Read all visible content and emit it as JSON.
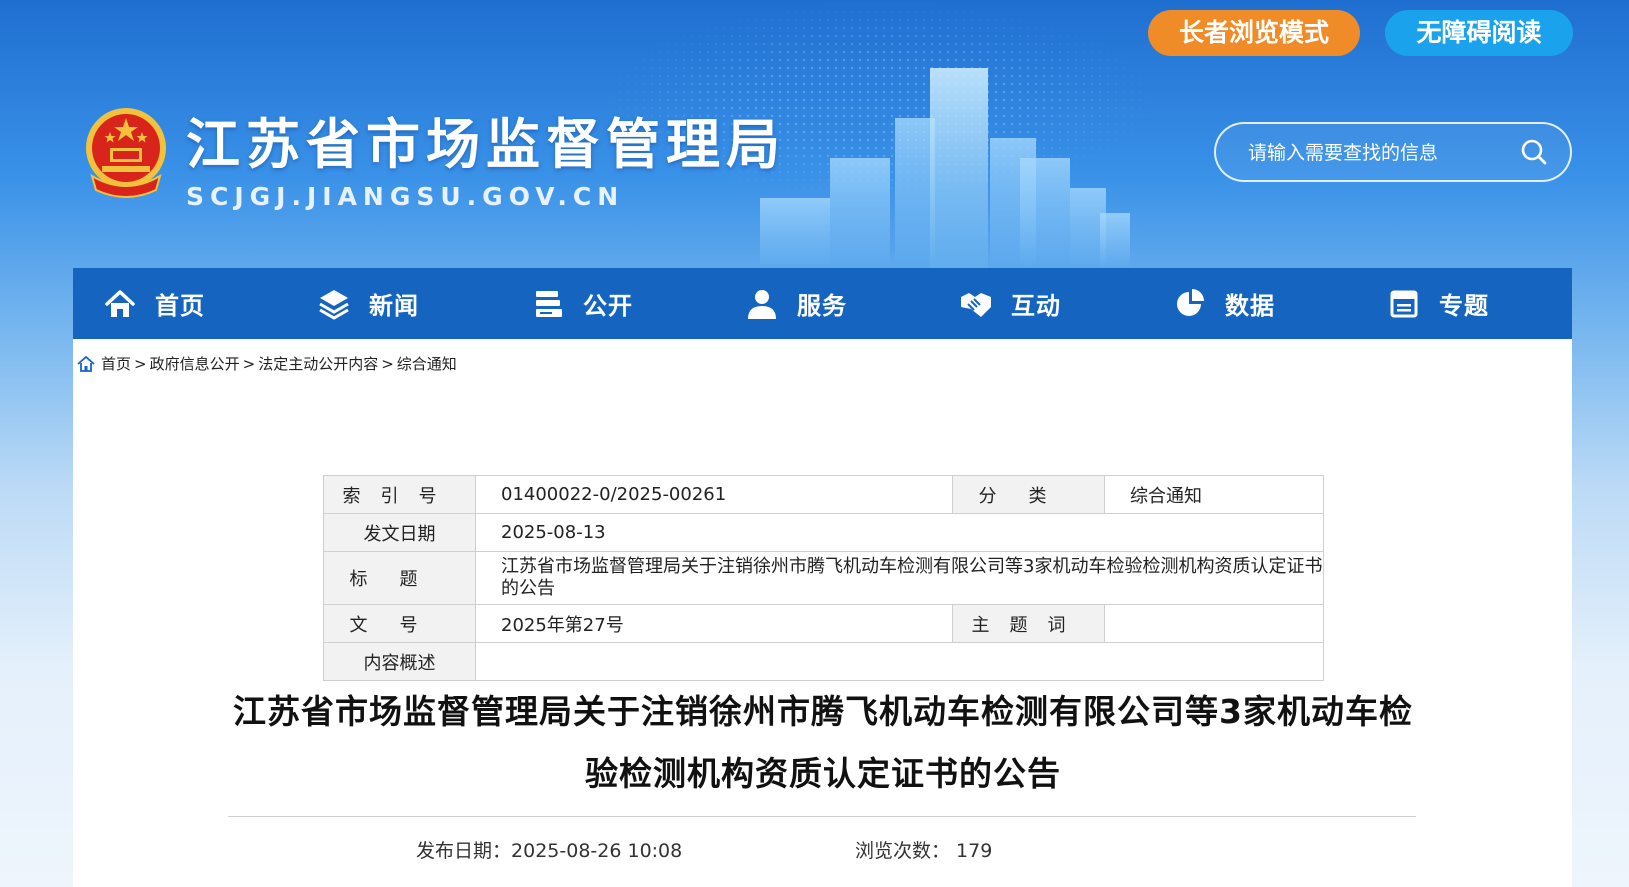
{
  "header": {
    "site_title": "江苏省市场监督管理局",
    "site_domain": "SCJGJ.JIANGSU.GOV.CN",
    "elder_mode_label": "长者浏览模式",
    "accessible_label": "无障碍阅读",
    "search_placeholder": "请输入需要查找的信息",
    "colors": {
      "elder": "#f08c27",
      "accessible": "#1aa3ec",
      "nav": "#1565c0"
    }
  },
  "nav": {
    "items": [
      {
        "label": "首页",
        "icon": "home-icon"
      },
      {
        "label": "新闻",
        "icon": "layers-icon"
      },
      {
        "label": "公开",
        "icon": "documents-icon"
      },
      {
        "label": "服务",
        "icon": "user-icon"
      },
      {
        "label": "互动",
        "icon": "handshake-icon"
      },
      {
        "label": "数据",
        "icon": "pie-chart-icon"
      },
      {
        "label": "专题",
        "icon": "window-icon"
      }
    ]
  },
  "breadcrumb": {
    "items": [
      "首页",
      "政府信息公开",
      "法定主动公开内容",
      "综合通知"
    ],
    "separator": ">"
  },
  "meta": {
    "index_label": "索引号",
    "index_value": "01400022-0/2025-00261",
    "category_label": "分类",
    "category_value": "综合通知",
    "date_label": "发文日期",
    "date_value": "2025-08-13",
    "title_label": "标题",
    "title_value": "江苏省市场监督管理局关于注销徐州市腾飞机动车检测有限公司等3家机动车检验检测机构资质认定证书的公告",
    "docno_label": "文号",
    "docno_value": "2025年第27号",
    "keywords_label": "主题词",
    "keywords_value": "",
    "summary_label": "内容概述",
    "summary_value": ""
  },
  "article": {
    "title_line1": "江苏省市场监督管理局关于注销徐州市腾飞机动车检测有限公司等3家机动车检",
    "title_line2": "验检测机构资质认定证书的公告",
    "publish_label": "发布日期：",
    "publish_value": "2025-08-26 10:08",
    "views_label": "浏览次数：",
    "views_value": "179"
  }
}
